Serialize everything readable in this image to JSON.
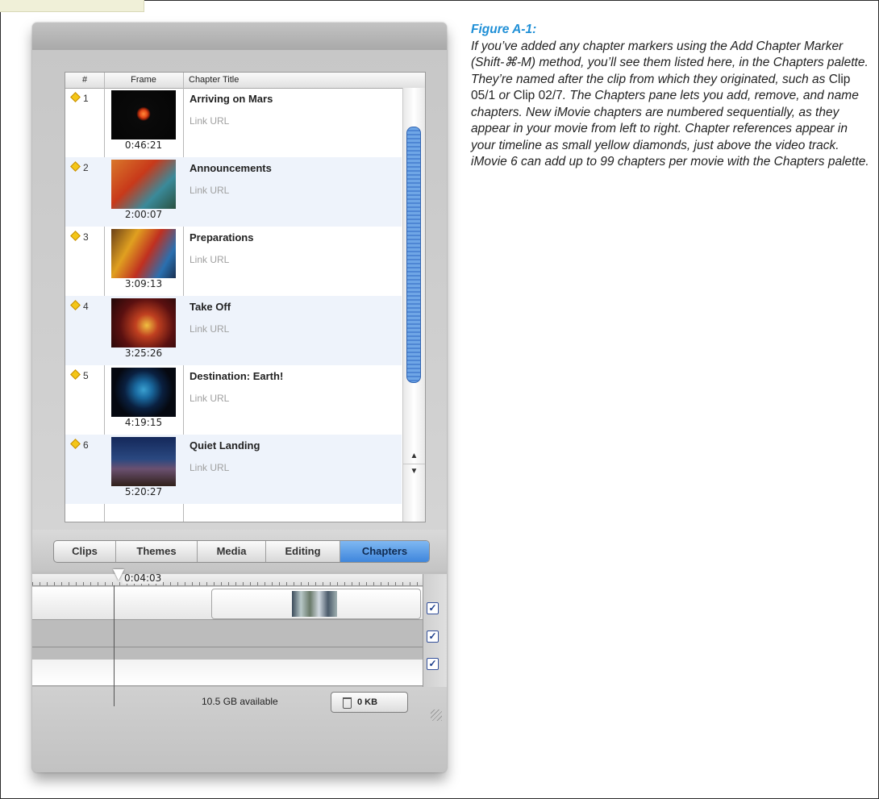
{
  "chapters_table": {
    "headers": {
      "num": "#",
      "frame": "Frame",
      "title": "Chapter Title"
    },
    "rows": [
      {
        "num": "1",
        "title": "Arriving on Mars",
        "url": "Link URL",
        "timecode": "0:46:21"
      },
      {
        "num": "2",
        "title": "Announcements",
        "url": "Link URL",
        "timecode": "2:00:07"
      },
      {
        "num": "3",
        "title": "Preparations",
        "url": "Link URL",
        "timecode": "3:09:13"
      },
      {
        "num": "4",
        "title": "Take Off",
        "url": "Link URL",
        "timecode": "3:25:26"
      },
      {
        "num": "5",
        "title": "Destination: Earth!",
        "url": "Link URL",
        "timecode": "4:19:15"
      },
      {
        "num": "6",
        "title": "Quiet Landing",
        "url": "Link URL",
        "timecode": "5:20:27"
      }
    ]
  },
  "pane_buttons": {
    "items": [
      "Clips",
      "Themes",
      "Media",
      "Editing",
      "Chapters"
    ],
    "selected": "Chapters"
  },
  "timeline": {
    "playhead_time": "0:04:03",
    "track_checkboxes": [
      true,
      true,
      true
    ]
  },
  "status_bar": {
    "space_available": "10.5 GB available",
    "trash_size": "0 KB"
  },
  "caption": {
    "figure_label": "Figure A-1:",
    "part1": "If you’ve added any chapter markers using the Add Chapter Marker (Shift-⌘-M) method, you’ll see them listed here, in the Chapters palette. They’re named after the clip from which they originated, such as ",
    "clip_a": "Clip 05/1",
    "part2": " or ",
    "clip_b": "Clip 02/7",
    "part3": ". The Chapters pane lets you add, remove, and name chapters. New iMovie chapters are numbered sequentially, as they appear in your movie from left to right. Chapter references appear in your timeline as small yellow diamonds, just above the video track. iMovie 6 can add up to 99 chapters per movie with the Chapters palette."
  },
  "colors": {
    "caption_title": "#1f8fd6",
    "chapter_marker": "#f4c617",
    "selected_tab": "#3f86dc"
  }
}
